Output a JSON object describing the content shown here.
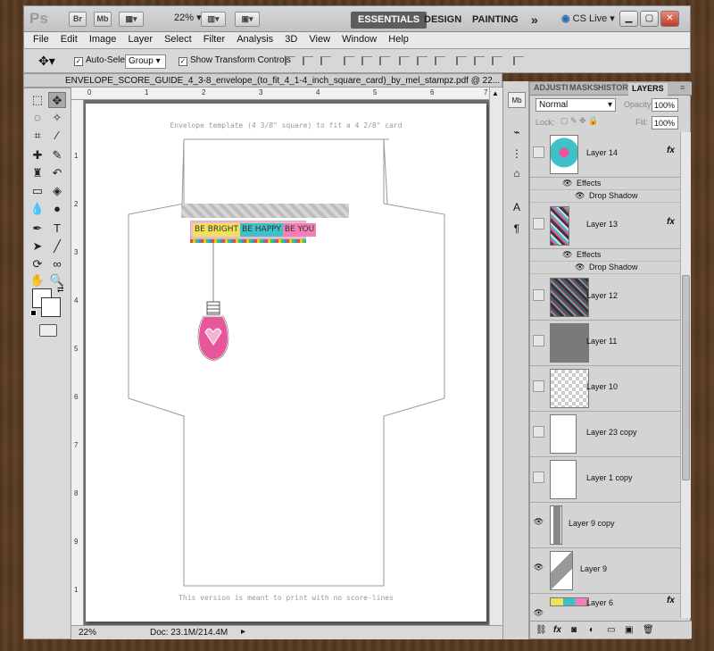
{
  "app": {
    "logo": "Ps",
    "bridge_btn": "Br",
    "minibridge_btn": "Mb",
    "zoom": "22%",
    "workspaces": [
      "ESSENTIALS",
      "DESIGN",
      "PAINTING"
    ],
    "more": "»",
    "cs_live": "CS Live"
  },
  "menu": [
    "File",
    "Edit",
    "Image",
    "Layer",
    "Select",
    "Filter",
    "Analysis",
    "3D",
    "View",
    "Window",
    "Help"
  ],
  "options": {
    "auto_select_label": "Auto-Select:",
    "auto_select_value": "Group",
    "show_transform_label": "Show Transform Controls"
  },
  "document": {
    "tab_title": "ENVELOPE_SCORE_GUIDE_4_3-8_envelope_(to_fit_4_1-4_inch_square_card)_by_mel_stampz.pdf @ 22...",
    "header_text": "Envelope template (4 3/8\" square) to fit a 4 2/8\" card",
    "footer_text": "This version is meant to print with no score-lines",
    "sentiment": [
      "BE BRIGHT",
      "BE HAPPY",
      "BE YOU"
    ],
    "ruler_top": [
      "0",
      "1",
      "2",
      "3",
      "4",
      "5",
      "6",
      "7"
    ],
    "ruler_left": [
      "1",
      "2",
      "3",
      "4",
      "5",
      "6",
      "7",
      "8",
      "9",
      "1"
    ]
  },
  "status": {
    "zoom": "22%",
    "doc": "Doc: 23.1M/214.4M"
  },
  "layers_panel": {
    "tabs": [
      "ADJUSTI",
      "MASKS",
      "HISTOR",
      "LAYERS"
    ],
    "blend_mode": "Normal",
    "opacity_label": "Opacity:",
    "opacity_value": "100%",
    "lock_label": "Lock:",
    "fill_label": "Fill:",
    "fill_value": "100%",
    "effects_label": "Effects",
    "drop_shadow_label": "Drop Shadow",
    "layers": [
      {
        "name": "Layer 14",
        "visible": false,
        "fx": true
      },
      {
        "name": "Layer 13",
        "visible": false,
        "fx": true
      },
      {
        "name": "Layer 12",
        "visible": false,
        "fx": false
      },
      {
        "name": "Layer 11",
        "visible": false,
        "fx": false
      },
      {
        "name": "Layer 10",
        "visible": false,
        "fx": false
      },
      {
        "name": "Layer 23 copy",
        "visible": false,
        "fx": false
      },
      {
        "name": "Layer 1 copy",
        "visible": false,
        "fx": false
      },
      {
        "name": "Layer 9 copy",
        "visible": true,
        "fx": false
      },
      {
        "name": "Layer 9",
        "visible": true,
        "fx": false
      },
      {
        "name": "Layer 6",
        "visible": true,
        "fx": true
      }
    ],
    "fx_label": "fx"
  },
  "colors": {
    "accent_pink": "#e7559b",
    "teal": "#3fc1c9",
    "yellow": "#f1e05a"
  }
}
